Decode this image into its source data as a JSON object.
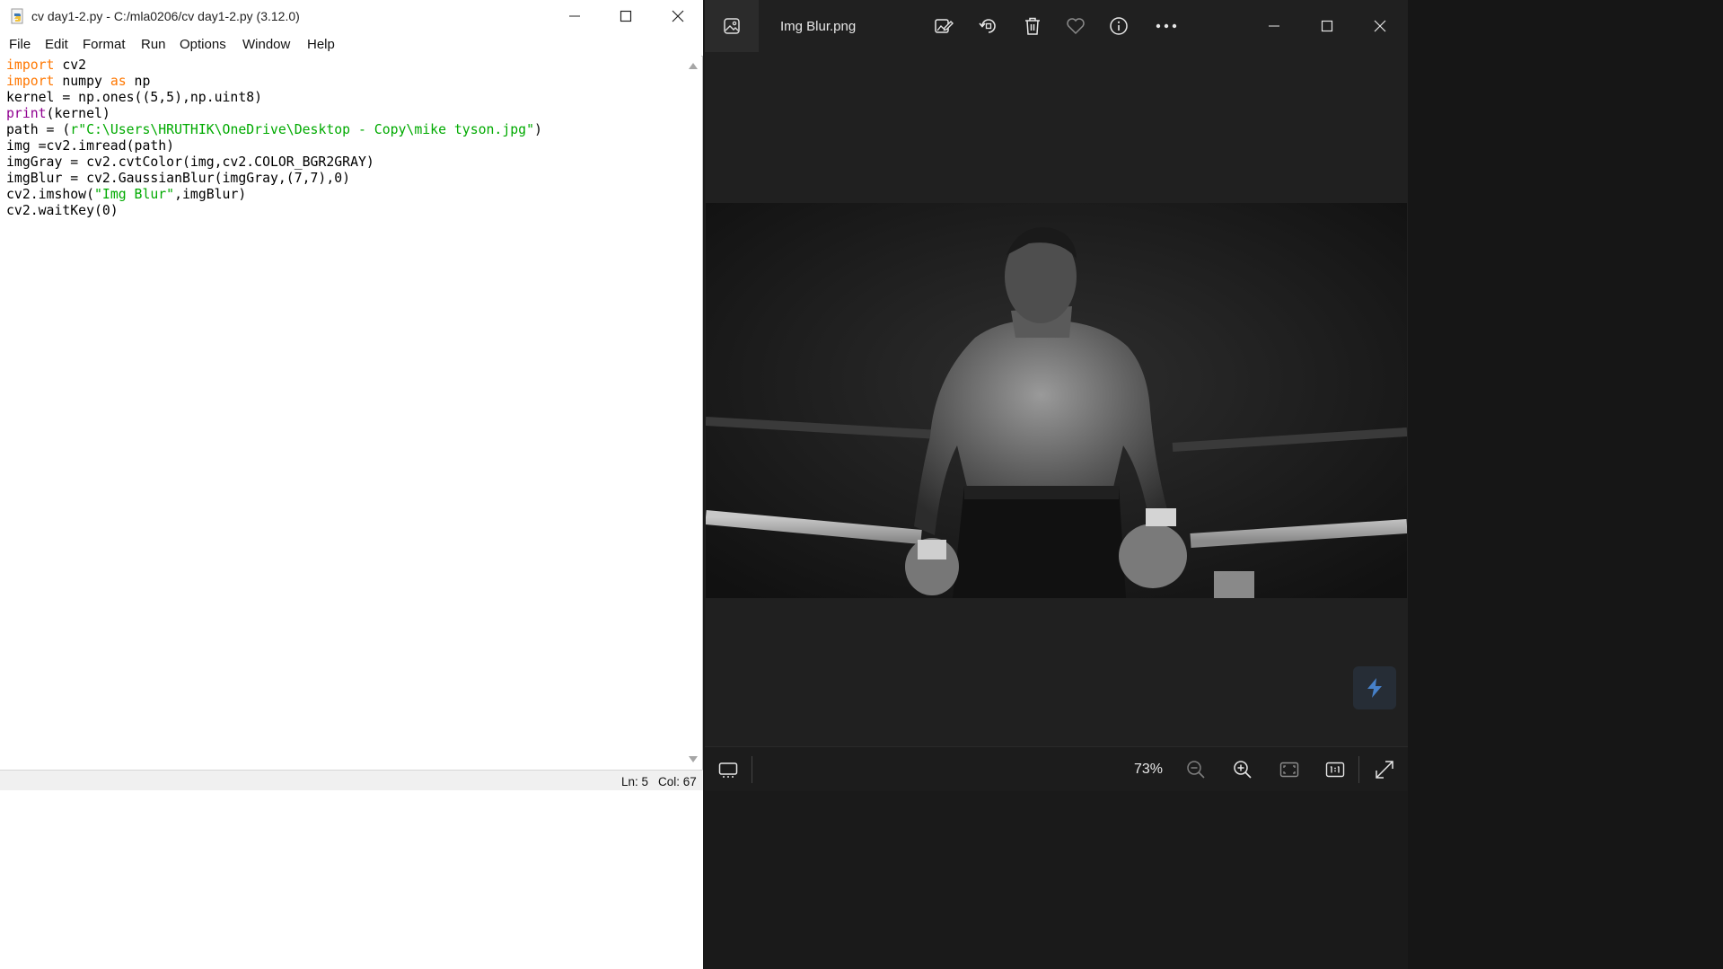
{
  "idle": {
    "title": "cv day1-2.py - C:/mla0206/cv day1-2.py (3.12.0)",
    "menu": [
      "File",
      "Edit",
      "Format",
      "Run",
      "Options",
      "Window",
      "Help"
    ],
    "code": [
      [
        {
          "t": "import",
          "c": "kw"
        },
        {
          "t": " cv2",
          "c": ""
        }
      ],
      [
        {
          "t": "import",
          "c": "kw"
        },
        {
          "t": " numpy ",
          "c": ""
        },
        {
          "t": "as",
          "c": "kw"
        },
        {
          "t": " np",
          "c": ""
        }
      ],
      [
        {
          "t": "kernel = np.ones((5,5),np.uint8)",
          "c": ""
        }
      ],
      [
        {
          "t": "print",
          "c": "bi"
        },
        {
          "t": "(kernel)",
          "c": ""
        }
      ],
      [
        {
          "t": "path = (",
          "c": ""
        },
        {
          "t": "r\"C:\\Users\\HRUTHIK\\OneDrive\\Desktop - Copy\\mike tyson.jpg\"",
          "c": "st"
        },
        {
          "t": ")",
          "c": ""
        }
      ],
      [
        {
          "t": "img =cv2.imread(path)",
          "c": ""
        }
      ],
      [
        {
          "t": "imgGray = cv2.cvtColor(img,cv2.COLOR_BGR2GRAY)",
          "c": ""
        }
      ],
      [
        {
          "t": "imgBlur = cv2.GaussianBlur(imgGray,(7,7),0)",
          "c": ""
        }
      ],
      [
        {
          "t": "cv2.imshow(",
          "c": ""
        },
        {
          "t": "\"Img Blur\"",
          "c": "st"
        },
        {
          "t": ",imgBlur)",
          "c": ""
        }
      ],
      [
        {
          "t": "cv2.waitKey(0)",
          "c": ""
        }
      ]
    ],
    "status": {
      "line": "Ln: 5",
      "col": "Col: 67"
    }
  },
  "photos": {
    "filename": "Img Blur.png",
    "zoom": "73%",
    "toolbar_icons": [
      "edit-image-icon",
      "rotate-icon",
      "delete-icon",
      "favorite-heart-icon",
      "info-icon",
      "more-icon"
    ],
    "bottom_icons": [
      "filmstrip-icon",
      "zoom-out-icon",
      "zoom-in-icon",
      "fit-to-window-icon",
      "actual-size-icon",
      "full-screen-icon"
    ]
  },
  "colors": {
    "keyword": "#ff7700",
    "builtin": "#900090",
    "string": "#00aa00",
    "viewer_bg": "#202020"
  }
}
